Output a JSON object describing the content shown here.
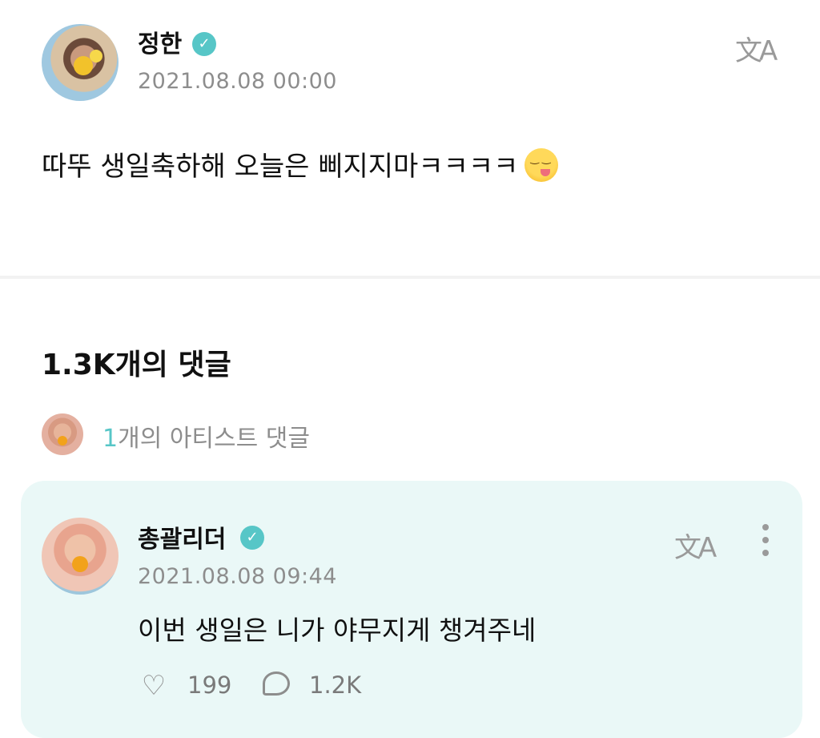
{
  "post": {
    "author": "정한",
    "timestamp": "2021.08.08 00:00",
    "body": "따뚜 생일축하해 오늘은 삐지지마ㅋㅋㅋㅋ",
    "emoji": "😋",
    "translate_icon": "translate-icon"
  },
  "comments_section": {
    "count_label": "1.3K개의 댓글",
    "artist_comment_count": "1",
    "artist_comment_label": "개의 아티스트 댓글"
  },
  "comment": {
    "author": "총괄리더",
    "timestamp": "2021.08.08 09:44",
    "body": "이번 생일은 니가 야무지게 챙겨주네",
    "like_count": "199",
    "reply_count": "1.2K",
    "icons": [
      "translate-icon",
      "more-options-icon",
      "like-icon",
      "reply-icon"
    ]
  },
  "colors": {
    "accent": "#57c6c7",
    "comment_bg": "#eaf8f7",
    "muted_text": "#8d8d8d"
  }
}
